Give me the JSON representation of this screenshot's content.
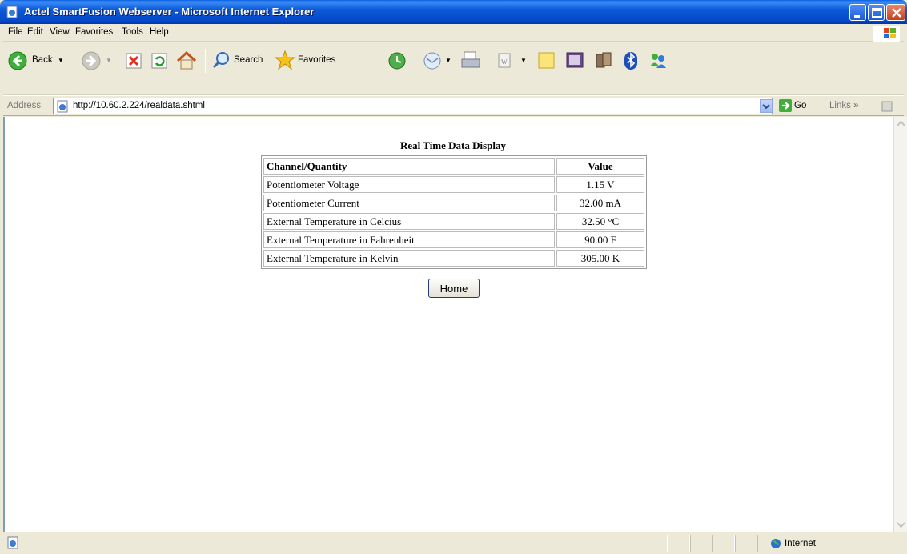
{
  "window": {
    "title": "Actel SmartFusion Webserver - Microsoft Internet Explorer"
  },
  "menu": {
    "items": [
      "File",
      "Edit",
      "View",
      "Favorites",
      "Tools",
      "Help"
    ]
  },
  "toolbar": {
    "back_label": "Back",
    "search_label": "Search",
    "favorites_label": "Favorites"
  },
  "address": {
    "label": "Address",
    "url": "http://10.60.2.224/realdata.shtml",
    "go_label": "Go",
    "links_label": "Links"
  },
  "page": {
    "title": "Real Time Data Display",
    "columns": [
      "Channel/Quantity",
      "Value"
    ],
    "rows": [
      {
        "quantity": "Potentiometer Voltage",
        "value": "1.15 V"
      },
      {
        "quantity": "Potentiometer Current",
        "value": "32.00 mA"
      },
      {
        "quantity": "External Temperature in Celcius",
        "value": "32.50 °C"
      },
      {
        "quantity": "External Temperature in Fahrenheit",
        "value": "90.00 F"
      },
      {
        "quantity": "External Temperature in Kelvin",
        "value": "305.00 K"
      }
    ],
    "home_button": "Home"
  },
  "status": {
    "zone": "Internet"
  }
}
